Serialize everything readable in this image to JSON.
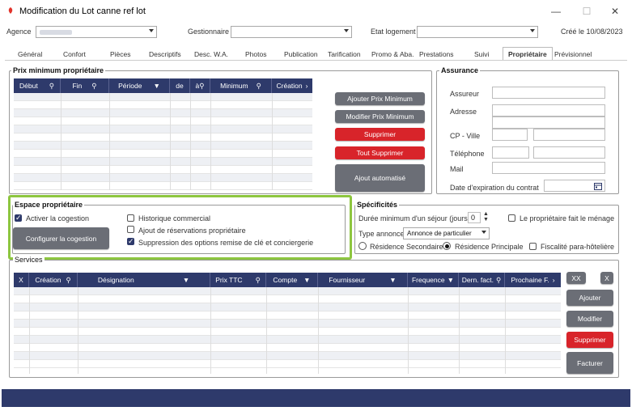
{
  "window": {
    "title": "Modification du Lot canne ref lot",
    "minimize": "—",
    "maximize": "☐",
    "close": "✕"
  },
  "header": {
    "agence_label": "Agence",
    "agence_value": "",
    "gestionnaire_label": "Gestionnaire",
    "gestionnaire_value": "",
    "etat_label": "Etat logement",
    "etat_value": "",
    "created": "Créé le 10/08/2023"
  },
  "tabs": [
    "Général",
    "Confort",
    "Pièces",
    "Descriptifs",
    "Desc. W.A.",
    "Photos",
    "Publication",
    "Tarification",
    "Promo & Aba.",
    "Prestations",
    "Suivi",
    "Propriétaire",
    "Prévisionnel"
  ],
  "prix": {
    "title": "Prix minimum propriétaire",
    "columns": [
      "Début",
      "Fin",
      "Période",
      "de",
      "à",
      "Minimum",
      "Création"
    ],
    "buttons": {
      "ajouter": "Ajouter Prix Minimum",
      "modifier": "Modifier Prix Minimum",
      "supprimer": "Supprimer",
      "tout_supprimer": "Tout Supprimer",
      "auto": "Ajout automatisé"
    }
  },
  "assurance": {
    "title": "Assurance",
    "assureur": "Assureur",
    "adresse": "Adresse",
    "cp": "CP - Ville",
    "tel": "Téléphone",
    "mail": "Mail",
    "expiration": "Date d'expiration du contrat"
  },
  "espace": {
    "title": "Espace propriétaire",
    "activer": "Activer la cogestion",
    "configurer": "Configurer la cogestion",
    "historique": "Historique commercial",
    "ajout_resa": "Ajout de réservations propriétaire",
    "suppression": "Suppression des options remise de clé et conciergerie"
  },
  "specificites": {
    "title": "Spécificités",
    "duree_label": "Durée minimum d'un séjour (jours)",
    "duree_value": "0",
    "menage": "Le propriétaire fait le ménage",
    "type_label": "Type annonce",
    "type_value": "Annonce de particulier",
    "res_secondaire": "Résidence Secondaire",
    "res_principale": "Résidence Principale",
    "fiscalite": "Fiscalité para-hôtelière"
  },
  "services": {
    "title": "Services",
    "columns": [
      "X",
      "Création",
      "Désignation",
      "Prix TTC",
      "Compte",
      "Fournisseur",
      "Frequence",
      "Dern. fact.",
      "Prochaine F."
    ],
    "buttons": {
      "xx": "XX",
      "x": "X",
      "ajouter": "Ajouter",
      "modifier": "Modifier",
      "supprimer": "Supprimer",
      "facturer": "Facturer"
    }
  },
  "colors": {
    "accent": "#2e3a6b",
    "danger": "#d8242a",
    "highlight": "#8dc63f"
  }
}
